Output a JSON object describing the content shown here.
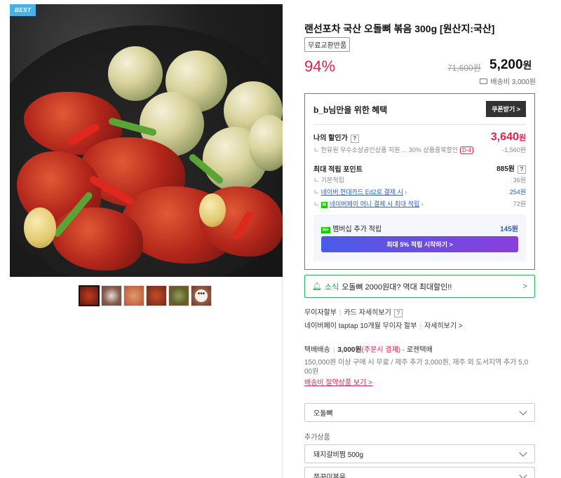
{
  "image": {
    "badge": "BEST",
    "thumbnails": [
      "photo-1",
      "photo-2",
      "photo-3",
      "photo-4",
      "photo-5",
      "photo-6"
    ],
    "more_icon": "•••"
  },
  "product": {
    "title": "랜선포차 국산 오돌뼈 볶음 300g [원산지:국산]",
    "tag": "무료교환반품",
    "discount_rate": "94%",
    "original_price": "71,600원",
    "sale_price": "5,200",
    "sale_unit": "원",
    "shipping_fee": "배송비 3,000원"
  },
  "benefit": {
    "header": "b_b님만을 위한 혜택",
    "coupon_button": "쿠폰받기 >",
    "my_price_label": "나의 할인가",
    "my_price": "3,640",
    "my_price_unit": "원",
    "discount_desc": "한유원 우수소상공인상품 지원 ...  30% 상품중복할인",
    "dday": "D-4",
    "discount_amount": "-1,560원",
    "points_label": "최대 적립 포인트",
    "points_value": "885원",
    "basic_label": "기본적립",
    "basic_value": "36원",
    "card_label": "네이버 현대카드 Ed2로 결제 시",
    "card_value": "254원",
    "npay_label": "네이버페이 머니 결제 시 최대 적립",
    "npay_value": "72원",
    "npay_badge": "N",
    "membership_badge": "N+",
    "membership_label": "멤버십 추가 적립",
    "membership_value": "145원",
    "membership_button": "최대 5% 적립 시작하기 >"
  },
  "notice": {
    "prefix": "소식",
    "text": "오돌뼈 2000원대? 역대 최대할인!!",
    "chevron": ">"
  },
  "payment": {
    "interest_free": "무이자할부",
    "card_view": "카드 자세히보기",
    "taptap": "네이버페이 taptap 10개월 무이자 할부",
    "taptap_view": "자세히보기 >"
  },
  "delivery": {
    "type": "택배배송",
    "fee": "3,000원",
    "fee_note": "(주문시 결제)",
    "carrier": "· 로젠택배",
    "condition_line1": "150,000원 이상 구매 시 무료 / 제주 추가 3,000원, 제주 외 도서지역 추가 5,0",
    "condition_line2": "00원",
    "saving_link": "배송비 절약상품 보기 >"
  },
  "options": {
    "main_select": "오돌뼈",
    "addon_label": "추가상품",
    "addon_select_1": "돼지갈비찜 500g",
    "addon_select_2": "쭈꾸미볶음"
  }
}
